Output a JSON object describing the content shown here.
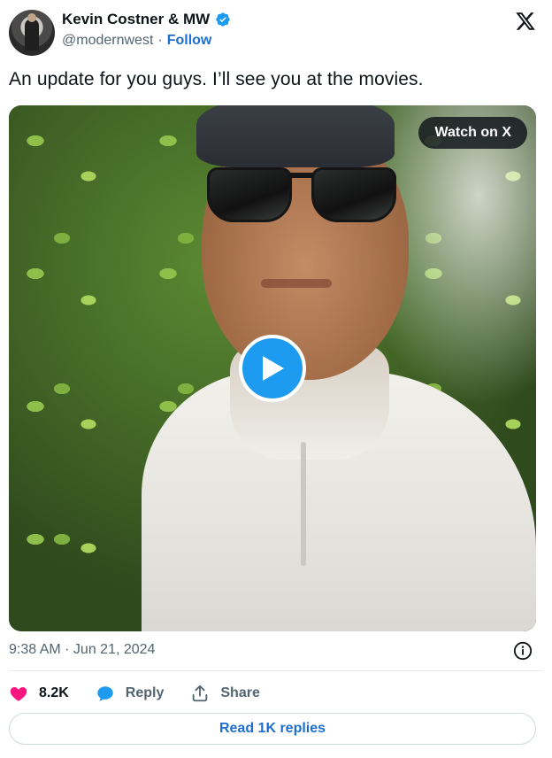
{
  "author": {
    "display_name": "Kevin Costner & MW",
    "handle": "@modernwest",
    "separator": "·",
    "follow_label": "Follow",
    "verified_color": "#1d9bf0"
  },
  "tweet": {
    "text": "An update for you guys. I’ll see you at the movies.",
    "timestamp": "9:38 AM · Jun 21, 2024"
  },
  "media": {
    "watch_label": "Watch on X",
    "play_color": "#1d9bf0"
  },
  "actions": {
    "like_count": "8.2K",
    "like_color": "#f91880",
    "reply_label": "Reply",
    "share_label": "Share"
  },
  "footer": {
    "read_replies_label": "Read 1K replies"
  },
  "icons": [
    "x-logo-icon",
    "verified-badge-icon",
    "play-icon",
    "info-icon",
    "heart-icon",
    "reply-bubble-icon",
    "share-icon"
  ]
}
